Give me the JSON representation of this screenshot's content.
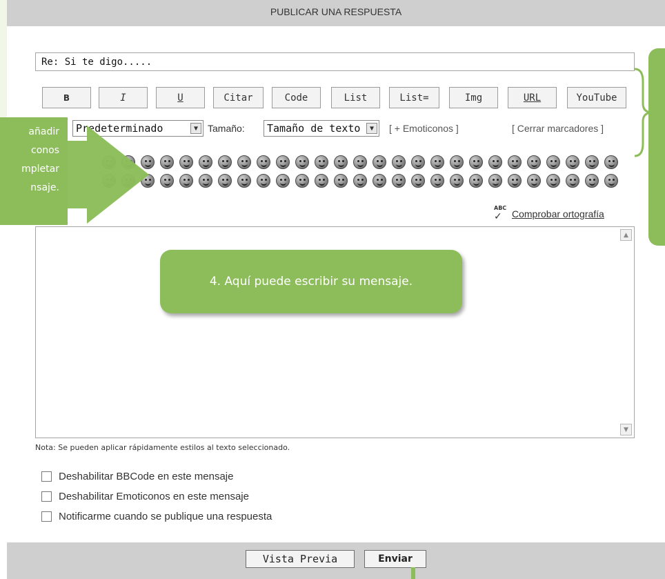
{
  "header": {
    "title": "PUBLICAR UNA RESPUESTA"
  },
  "subject": {
    "value": "Re: Si te digo....."
  },
  "toolbar": {
    "buttons": [
      "B",
      "I",
      "U",
      "Citar",
      "Code",
      "List",
      "List=",
      "Img",
      "URL",
      "YouTube"
    ]
  },
  "font_row": {
    "font_select_value": "Predeterminado",
    "size_label": "Tamaño:",
    "size_select_value": "Tamaño de texto",
    "emoticons_link": "[ + Emoticonos ]",
    "close_tags_link": "[ Cerrar marcadores ]"
  },
  "spellcheck": {
    "icon_text": "ABC",
    "label": "Comprobar ortografía"
  },
  "note": "Nota: Se pueden aplicar rápidamente estilos al texto seleccionado.",
  "options": [
    "Deshabilitar BBCode en este mensaje",
    "Deshabilitar Emoticonos en este mensaje",
    "Notificarme cuando se publique una respuesta"
  ],
  "footer": {
    "preview_label": "Vista Previa",
    "submit_label": "Enviar"
  },
  "callouts": {
    "left_lines": [
      "añadir",
      "conos",
      "mpletar",
      "nsaje."
    ],
    "bubble_text": "4. Aquí puede escribir su mensaje."
  },
  "colors": {
    "accent_green": "#8cbd5a",
    "bar_gray": "#cfcfcf"
  },
  "icons": {
    "emoticon": "smiley-icon",
    "spellcheck": "spellcheck-icon",
    "scroll_up": "scroll-up-arrow-icon",
    "scroll_down": "scroll-down-arrow-icon"
  }
}
